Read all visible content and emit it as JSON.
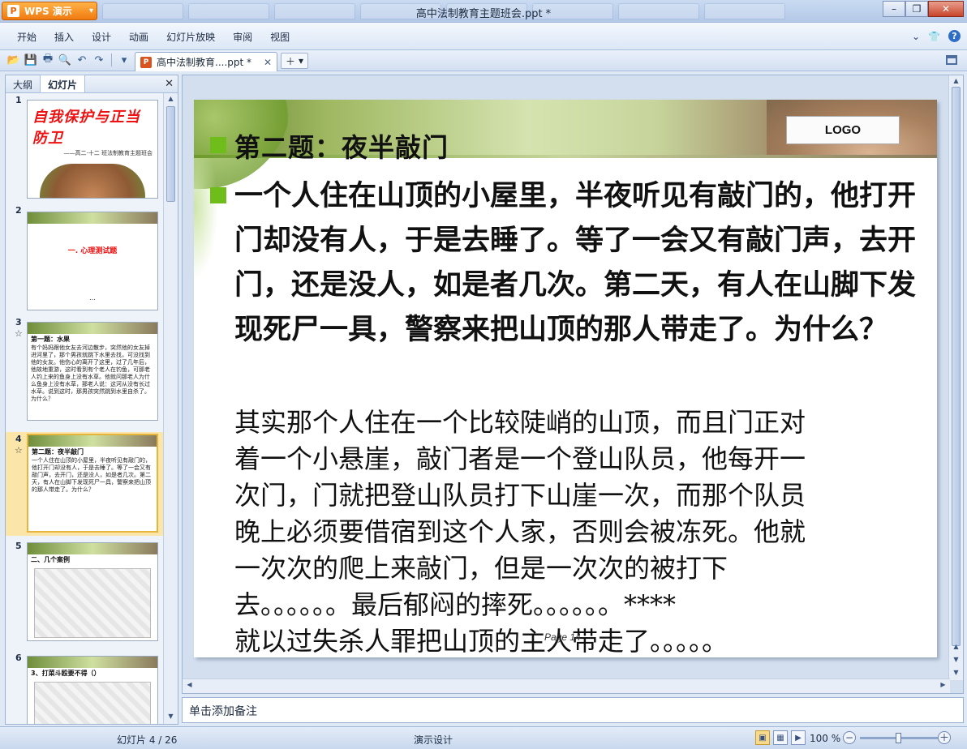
{
  "app": {
    "button_label": "WPS 演示",
    "window_title": "高中法制教育主题班会.ppt *"
  },
  "menu": [
    "开始",
    "插入",
    "设计",
    "动画",
    "幻灯片放映",
    "审阅",
    "视图"
  ],
  "toolbar": {
    "doc_tab_label": "高中法制教育....ppt *"
  },
  "left_panel": {
    "tabs": [
      "大纲",
      "幻灯片"
    ],
    "thumbnails": [
      {
        "num": "1",
        "title": "自我保护与正当防卫",
        "subtitle": "——高二·十二 班法制教育主题班会"
      },
      {
        "num": "2",
        "center_text": "一. 心理测试题",
        "dots": "..."
      },
      {
        "num": "3",
        "title": "第一题：水果",
        "text": "有个妈妈跟他女友去河边散步，突然他的女友掉进河里了，那个男孩就跳下水里去找，可没找到他的女友。他伤心的离开了这里，过了几年后，他故地重游，这时看到有个老人在钓鱼，可那老人钓上来的鱼身上没有水草。他就问那老人为什么鱼身上没有水草，那老人说：这河从没有长过水草。说到这时，那男孩突然跳到水里自杀了。为什么？"
      },
      {
        "num": "4",
        "title": "第二题：夜半敲门",
        "text": "一个人住在山顶的小屋里，半夜听见有敲门的，他打开门却没有人，于是去睡了。等了一会又有敲门声，去开门，还是没人，如是者几次。第二天，有人在山脚下发现死尸一具，警察来把山顶的那人带走了。为什么？"
      },
      {
        "num": "5",
        "title": "二、几个案例"
      },
      {
        "num": "6",
        "title": "3、打菜斗殴要不得（）"
      }
    ]
  },
  "slide": {
    "logo": "LOGO",
    "title": "第二题：夜半敲门",
    "question": "一个人住在山顶的小屋里，半夜听见有敲门的，他打开门却没有人，于是去睡了。等了一会又有敲门声，去开门，还是没人，如是者几次。第二天，有人在山脚下发现死尸一具，警察来把山顶的那人带走了。为什么？",
    "answer_lines": [
      "其实那个人住在一个比较陡峭的山顶，而且门正对",
      "着一个小悬崖，敲门者是一个登山队员，他每开一",
      "次门，门就把登山队员打下山崖一次，而那个队员",
      "晚上必须要借宿到这个人家，否则会被冻死。他就",
      "一次次的爬上来敲门，但是一次次的被打下",
      "去。。。。。。最后郁闷的摔死。。。。。。****",
      "就以过失杀人罪把山顶的主人带走了。。。。。"
    ],
    "page_label": "Page 14"
  },
  "notes": {
    "placeholder": "单击添加备注"
  },
  "status": {
    "slide_counter": "幻灯片 4 / 26",
    "theme": "演示设计",
    "zoom": "100 %",
    "zoom_level": 0.5
  },
  "colors": {
    "accent_green": "#6fbd1a",
    "selected_thumb": "#fbe5a9",
    "wps_orange": "#f07a10"
  }
}
